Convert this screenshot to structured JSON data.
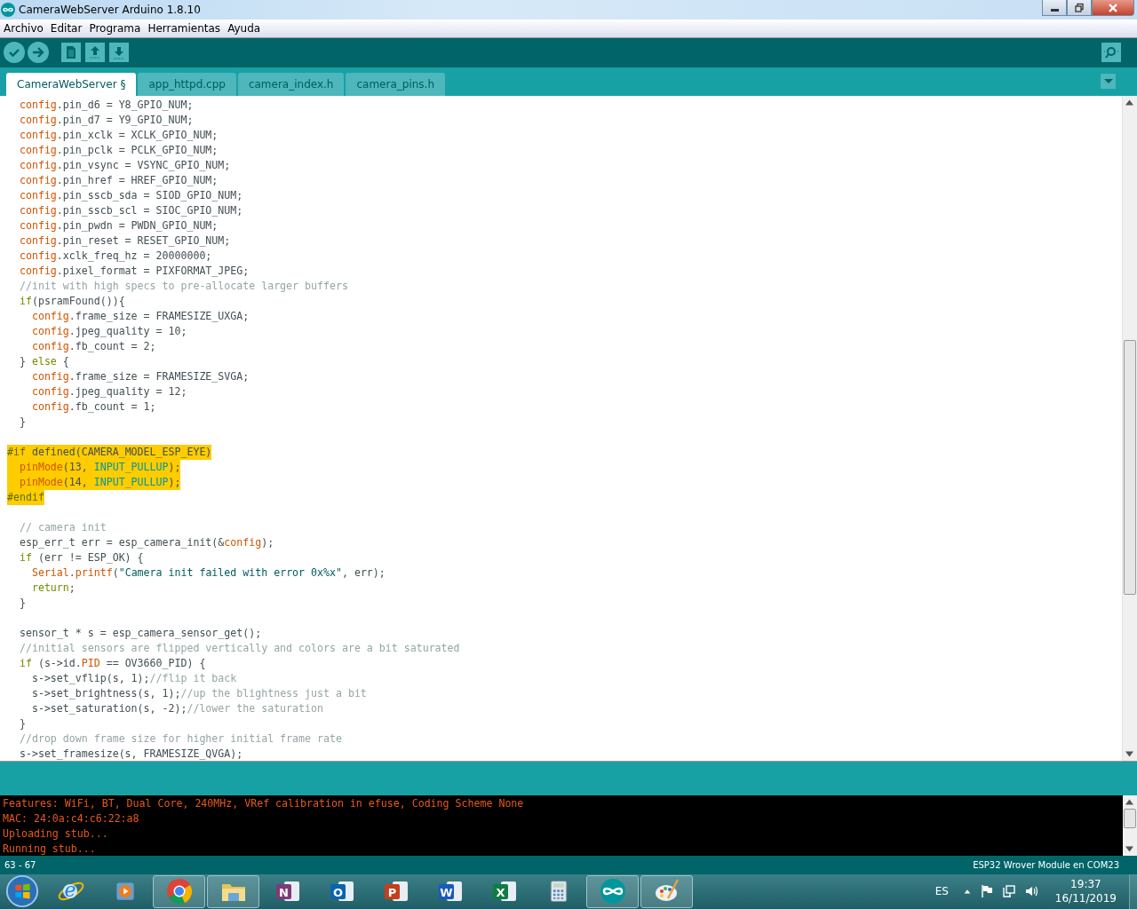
{
  "window": {
    "title": "CameraWebServer Arduino 1.8.10"
  },
  "menu": [
    "Archivo",
    "Editar",
    "Programa",
    "Herramientas",
    "Ayuda"
  ],
  "tabs": [
    {
      "label": "CameraWebServer §",
      "selected": true
    },
    {
      "label": "app_httpd.cpp",
      "selected": false
    },
    {
      "label": "camera_index.h",
      "selected": false
    },
    {
      "label": "camera_pins.h",
      "selected": false
    }
  ],
  "code": [
    {
      "highlight": false,
      "parts": [
        {
          "kind": "obj",
          "text": "  config"
        },
        {
          "kind": "plain",
          "text": ".pin_d6 = Y8_GPIO_NUM;"
        }
      ]
    },
    {
      "highlight": false,
      "parts": [
        {
          "kind": "obj",
          "text": "  config"
        },
        {
          "kind": "plain",
          "text": ".pin_d7 = Y9_GPIO_NUM;"
        }
      ]
    },
    {
      "highlight": false,
      "parts": [
        {
          "kind": "obj",
          "text": "  config"
        },
        {
          "kind": "plain",
          "text": ".pin_xclk = XCLK_GPIO_NUM;"
        }
      ]
    },
    {
      "highlight": false,
      "parts": [
        {
          "kind": "obj",
          "text": "  config"
        },
        {
          "kind": "plain",
          "text": ".pin_pclk = PCLK_GPIO_NUM;"
        }
      ]
    },
    {
      "highlight": false,
      "parts": [
        {
          "kind": "obj",
          "text": "  config"
        },
        {
          "kind": "plain",
          "text": ".pin_vsync = VSYNC_GPIO_NUM;"
        }
      ]
    },
    {
      "highlight": false,
      "parts": [
        {
          "kind": "obj",
          "text": "  config"
        },
        {
          "kind": "plain",
          "text": ".pin_href = HREF_GPIO_NUM;"
        }
      ]
    },
    {
      "highlight": false,
      "parts": [
        {
          "kind": "obj",
          "text": "  config"
        },
        {
          "kind": "plain",
          "text": ".pin_sscb_sda = SIOD_GPIO_NUM;"
        }
      ]
    },
    {
      "highlight": false,
      "parts": [
        {
          "kind": "obj",
          "text": "  config"
        },
        {
          "kind": "plain",
          "text": ".pin_sscb_scl = SIOC_GPIO_NUM;"
        }
      ]
    },
    {
      "highlight": false,
      "parts": [
        {
          "kind": "obj",
          "text": "  config"
        },
        {
          "kind": "plain",
          "text": ".pin_pwdn = PWDN_GPIO_NUM;"
        }
      ]
    },
    {
      "highlight": false,
      "parts": [
        {
          "kind": "obj",
          "text": "  config"
        },
        {
          "kind": "plain",
          "text": ".pin_reset = RESET_GPIO_NUM;"
        }
      ]
    },
    {
      "highlight": false,
      "parts": [
        {
          "kind": "obj",
          "text": "  config"
        },
        {
          "kind": "plain",
          "text": ".xclk_freq_hz = 20000000;"
        }
      ]
    },
    {
      "highlight": false,
      "parts": [
        {
          "kind": "obj",
          "text": "  config"
        },
        {
          "kind": "plain",
          "text": ".pixel_format = PIXFORMAT_JPEG;"
        }
      ]
    },
    {
      "highlight": false,
      "parts": [
        {
          "kind": "comment",
          "text": "  //init with high specs to pre-allocate larger buffers"
        }
      ]
    },
    {
      "highlight": false,
      "parts": [
        {
          "kind": "keyword",
          "text": "  if"
        },
        {
          "kind": "plain",
          "text": "(psramFound()){"
        }
      ]
    },
    {
      "highlight": false,
      "parts": [
        {
          "kind": "obj",
          "text": "    config"
        },
        {
          "kind": "plain",
          "text": ".frame_size = FRAMESIZE_UXGA;"
        }
      ]
    },
    {
      "highlight": false,
      "parts": [
        {
          "kind": "obj",
          "text": "    config"
        },
        {
          "kind": "plain",
          "text": ".jpeg_quality = 10;"
        }
      ]
    },
    {
      "highlight": false,
      "parts": [
        {
          "kind": "obj",
          "text": "    config"
        },
        {
          "kind": "plain",
          "text": ".fb_count = 2;"
        }
      ]
    },
    {
      "highlight": false,
      "parts": [
        {
          "kind": "plain",
          "text": "  } "
        },
        {
          "kind": "keyword",
          "text": "else"
        },
        {
          "kind": "plain",
          "text": " {"
        }
      ]
    },
    {
      "highlight": false,
      "parts": [
        {
          "kind": "obj",
          "text": "    config"
        },
        {
          "kind": "plain",
          "text": ".frame_size = FRAMESIZE_SVGA;"
        }
      ]
    },
    {
      "highlight": false,
      "parts": [
        {
          "kind": "obj",
          "text": "    config"
        },
        {
          "kind": "plain",
          "text": ".jpeg_quality = 12;"
        }
      ]
    },
    {
      "highlight": false,
      "parts": [
        {
          "kind": "obj",
          "text": "    config"
        },
        {
          "kind": "plain",
          "text": ".fb_count = 1;"
        }
      ]
    },
    {
      "highlight": false,
      "parts": [
        {
          "kind": "plain",
          "text": "  }"
        }
      ]
    },
    {
      "blank": true
    },
    {
      "highlight": true,
      "parts": [
        {
          "kind": "preproc",
          "text": "#if"
        },
        {
          "kind": "plain",
          "text": " defined(CAMERA_MODEL_ESP_EYE)"
        }
      ]
    },
    {
      "highlight": true,
      "parts": [
        {
          "kind": "func",
          "text": "  pinMode"
        },
        {
          "kind": "plain",
          "text": "(13, "
        },
        {
          "kind": "const",
          "text": "INPUT_PULLUP"
        },
        {
          "kind": "plain",
          "text": ");"
        }
      ]
    },
    {
      "highlight": true,
      "parts": [
        {
          "kind": "func",
          "text": "  pinMode"
        },
        {
          "kind": "plain",
          "text": "(14, "
        },
        {
          "kind": "const",
          "text": "INPUT_PULLUP"
        },
        {
          "kind": "plain",
          "text": ");"
        }
      ]
    },
    {
      "highlight": true,
      "parts": [
        {
          "kind": "preproc",
          "text": "#endif"
        }
      ]
    },
    {
      "blank": true
    },
    {
      "highlight": false,
      "parts": [
        {
          "kind": "comment",
          "text": "  // camera init"
        }
      ]
    },
    {
      "highlight": false,
      "parts": [
        {
          "kind": "plain",
          "text": "  esp_err_t err = esp_camera_init(&"
        },
        {
          "kind": "obj",
          "text": "config"
        },
        {
          "kind": "plain",
          "text": ");"
        }
      ]
    },
    {
      "highlight": false,
      "parts": [
        {
          "kind": "keyword",
          "text": "  if"
        },
        {
          "kind": "plain",
          "text": " (err != ESP_OK) {"
        }
      ]
    },
    {
      "highlight": false,
      "parts": [
        {
          "kind": "obj",
          "text": "    Serial"
        },
        {
          "kind": "plain",
          "text": "."
        },
        {
          "kind": "func",
          "text": "printf"
        },
        {
          "kind": "plain",
          "text": "("
        },
        {
          "kind": "string",
          "text": "\"Camera init failed with error 0x%x\""
        },
        {
          "kind": "plain",
          "text": ", err);"
        }
      ]
    },
    {
      "highlight": false,
      "parts": [
        {
          "kind": "keyword",
          "text": "    return"
        },
        {
          "kind": "plain",
          "text": ";"
        }
      ]
    },
    {
      "highlight": false,
      "parts": [
        {
          "kind": "plain",
          "text": "  }"
        }
      ]
    },
    {
      "blank": true
    },
    {
      "highlight": false,
      "parts": [
        {
          "kind": "plain",
          "text": "  sensor_t * s = esp_camera_sensor_get();"
        }
      ]
    },
    {
      "highlight": false,
      "parts": [
        {
          "kind": "comment",
          "text": "  //initial sensors are flipped vertically and colors are a bit saturated"
        }
      ]
    },
    {
      "highlight": false,
      "parts": [
        {
          "kind": "keyword",
          "text": "  if"
        },
        {
          "kind": "plain",
          "text": " (s->id."
        },
        {
          "kind": "obj",
          "text": "PID"
        },
        {
          "kind": "plain",
          "text": " == OV3660_PID) {"
        }
      ]
    },
    {
      "highlight": false,
      "parts": [
        {
          "kind": "plain",
          "text": "    s->set_vflip(s, 1);"
        },
        {
          "kind": "comment",
          "text": "//flip it back"
        }
      ]
    },
    {
      "highlight": false,
      "parts": [
        {
          "kind": "plain",
          "text": "    s->set_brightness(s, 1);"
        },
        {
          "kind": "comment",
          "text": "//up the blightness just a bit"
        }
      ]
    },
    {
      "highlight": false,
      "parts": [
        {
          "kind": "plain",
          "text": "    s->set_saturation(s, -2);"
        },
        {
          "kind": "comment",
          "text": "//lower the saturation"
        }
      ]
    },
    {
      "highlight": false,
      "parts": [
        {
          "kind": "plain",
          "text": "  }"
        }
      ]
    },
    {
      "highlight": false,
      "parts": [
        {
          "kind": "comment",
          "text": "  //drop down frame size for higher initial frame rate"
        }
      ]
    },
    {
      "highlight": false,
      "parts": [
        {
          "kind": "plain",
          "text": "  s->set_framesize(s, FRAMESIZE_QVGA);"
        }
      ]
    }
  ],
  "console": [
    "Features: WiFi, BT, Dual Core, 240MHz, VRef calibration in efuse, Coding Scheme None",
    "MAC: 24:0a:c4:c6:22:a8",
    "Uploading stub...",
    "Running stub..."
  ],
  "status_bar": {
    "lines": "63 - 67",
    "board": "ESP32 Wrover Module en COM23"
  },
  "taskbar": {
    "apps": [
      {
        "kind": "ie",
        "glyph": "e",
        "running": false
      },
      {
        "kind": "media",
        "running": false
      },
      {
        "kind": "chrome",
        "running": true
      },
      {
        "kind": "folder",
        "running": true
      },
      {
        "kind": "letter",
        "glyph": "N",
        "color": "#80397b",
        "running": false
      },
      {
        "kind": "letter",
        "glyph": "O",
        "color": "#0a64ad",
        "running": false
      },
      {
        "kind": "letter",
        "glyph": "P",
        "color": "#c43e1c",
        "running": false
      },
      {
        "kind": "letter",
        "glyph": "W",
        "color": "#185abd",
        "running": false
      },
      {
        "kind": "letter",
        "glyph": "X",
        "color": "#107c41",
        "running": false
      },
      {
        "kind": "calc",
        "running": false
      },
      {
        "kind": "arduino",
        "running": true
      },
      {
        "kind": "paint",
        "running": true
      }
    ],
    "language": "ES",
    "time": "19:37",
    "date": "16/11/2019"
  }
}
